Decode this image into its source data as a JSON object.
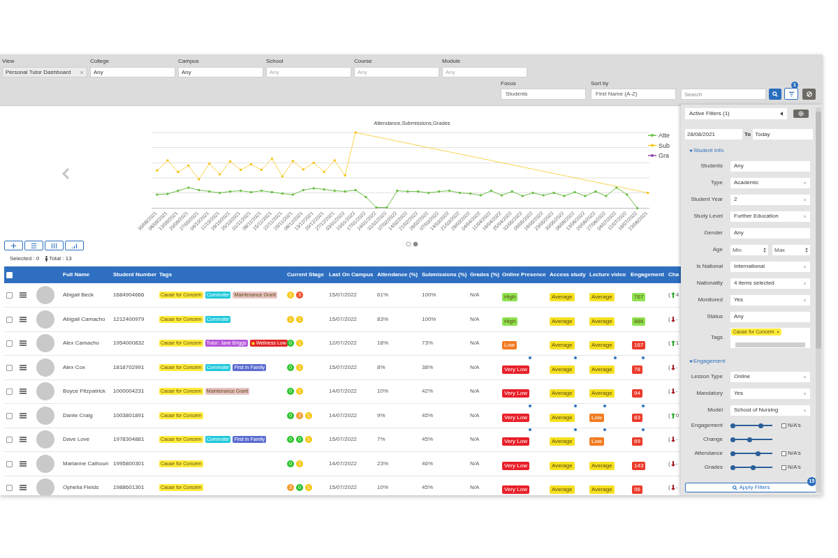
{
  "filters_bar": {
    "fields": [
      {
        "label": "View",
        "value": "Personal Tutor Dashboard",
        "clearable": true
      },
      {
        "label": "College",
        "value": "Any",
        "clearable": false
      },
      {
        "label": "Campus",
        "value": "Any",
        "clearable": false
      },
      {
        "label": "School",
        "placeholder": "Any",
        "clearable": false
      },
      {
        "label": "Course",
        "placeholder": "Any",
        "clearable": false
      },
      {
        "label": "Module",
        "placeholder": "Any",
        "clearable": false
      }
    ],
    "focus": {
      "label": "Focus",
      "value": "Students"
    },
    "sort": {
      "label": "Sort by",
      "value": "First Name (A-Z)"
    },
    "search": {
      "placeholder": "Search"
    },
    "filter_badge": "1"
  },
  "chart": {
    "title": "Attendance,Submissions,Grades",
    "x_labels": [
      "30/08/2021",
      "06/09/2021",
      "13/09/2021",
      "20/09/2021",
      "27/09/2021",
      "04/10/2021",
      "11/10/2021",
      "18/10/2021",
      "25/10/2021",
      "01/11/2021",
      "08/11/2021",
      "15/11/2021",
      "22/11/2021",
      "29/11/2021",
      "06/12/2021",
      "13/12/2021",
      "20/12/2021",
      "27/12/2021",
      "03/01/2022",
      "10/01/2022",
      "17/01/2022",
      "24/01/2022",
      "31/01/2022",
      "07/02/2022",
      "14/02/2022",
      "21/02/2022",
      "28/02/2022",
      "07/03/2022",
      "14/03/2022",
      "21/03/2022",
      "28/03/2022",
      "04/04/2022",
      "11/04/2022",
      "18/04/2022",
      "25/04/2022",
      "02/05/2022",
      "09/05/2022",
      "16/05/2022",
      "23/05/2022",
      "30/05/2022",
      "06/06/2022",
      "13/06/2022",
      "20/06/2022",
      "27/06/2022",
      "04/07/2022",
      "11/07/2022",
      "18/07/2022",
      "23/08/2021"
    ],
    "legend": [
      {
        "text": "Atte",
        "color": "#6cbf47"
      },
      {
        "text": "Sub",
        "color": "#f5c518"
      },
      {
        "text": "Gra",
        "color": "#8e44ad"
      }
    ],
    "carousel_dots": [
      {
        "selected": false
      },
      {
        "selected": true
      }
    ]
  },
  "summary": {
    "selected": "Selected : 0",
    "total": "Total : 13"
  },
  "table": {
    "select_all_checked": false,
    "columns": [
      "Full Name",
      "Student Number",
      "Tags",
      "Current Stage",
      "Last On Campus",
      "Attendance (%)",
      "Submissions (%)",
      "Grades (%)",
      "Online Presence",
      "Access study",
      "Lecture video",
      "Engagement",
      "Cha"
    ],
    "rows": [
      {
        "checked": false,
        "name": "Abigail Beck",
        "number": "1684904666",
        "tags": [
          {
            "text": "Cause for Concern",
            "color": "#ffeb3b",
            "has_icon": false
          },
          {
            "text": "Commuter",
            "color": "#1fc8db",
            "has_icon": false
          },
          {
            "text": "Maintenance Grant",
            "color": "#e8c4c4",
            "has_icon": false
          }
        ],
        "stages": [
          {
            "text": "1",
            "color": "#f7c71a"
          },
          {
            "text": "3",
            "color": "#f0502a"
          }
        ],
        "last_on_campus": "15/07/2022",
        "attendance": "61%",
        "submissions": "100%",
        "grades": "N/A",
        "online": {
          "text": "High",
          "color": "#8ee04e",
          "flag": false
        },
        "access": {
          "text": "Average",
          "color": "#f5e020",
          "flag": false
        },
        "lecture": {
          "text": "Average",
          "color": "#f5e020",
          "flag": false
        },
        "engagement": {
          "text": "767",
          "color": "#8ee04e",
          "flag": false
        },
        "change": {
          "prefix": "(",
          "rising": true,
          "value": "4"
        }
      },
      {
        "checked": false,
        "name": "Abigail Camacho",
        "number": "1212400979",
        "tags": [
          {
            "text": "Cause for Concern",
            "color": "#ffeb3b",
            "has_icon": false
          },
          {
            "text": "Commuter",
            "color": "#1fc8db",
            "has_icon": false
          }
        ],
        "stages": [
          {
            "text": "1",
            "color": "#f7c71a"
          },
          {
            "text": "1",
            "color": "#f7c71a"
          }
        ],
        "last_on_campus": "15/07/2022",
        "attendance": "83%",
        "submissions": "100%",
        "grades": "N/A",
        "online": {
          "text": "High",
          "color": "#8ee04e",
          "flag": false
        },
        "access": {
          "text": "Average",
          "color": "#f5e020",
          "flag": false
        },
        "lecture": {
          "text": "Average",
          "color": "#f5e020",
          "flag": false
        },
        "engagement": {
          "text": "886",
          "color": "#8ee04e",
          "flag": false
        },
        "change": {
          "prefix": "(",
          "rising": false,
          "value": "-"
        }
      },
      {
        "checked": false,
        "name": "Alex Camacho",
        "number": "1954000832",
        "tags": [
          {
            "text": "Cause for Concern",
            "color": "#ffeb3b",
            "has_icon": false
          },
          {
            "text": "Tutor: Jane Briggs",
            "color": "#b455d8",
            "has_icon": false
          },
          {
            "text": "Wellness Low",
            "color": "#e02424",
            "has_icon": true
          }
        ],
        "stages": [
          {
            "text": "0",
            "color": "#2bc42b"
          },
          {
            "text": "1",
            "color": "#f7c71a"
          }
        ],
        "last_on_campus": "12/07/2022",
        "attendance": "18%",
        "submissions": "73%",
        "grades": "N/A",
        "online": {
          "text": "Low",
          "color": "#f27c22",
          "flag": false
        },
        "access": {
          "text": "Average",
          "color": "#f5e020",
          "flag": false
        },
        "lecture": {
          "text": "Average",
          "color": "#f5e020",
          "flag": false
        },
        "engagement": {
          "text": "167",
          "color": "#ec3a2a",
          "flag": false
        },
        "change": {
          "prefix": "(",
          "rising": true,
          "value": "1"
        }
      },
      {
        "checked": false,
        "name": "Alex Cox",
        "number": "1818702991",
        "tags": [
          {
            "text": "Cause for Concern",
            "color": "#ffeb3b",
            "has_icon": false
          },
          {
            "text": "Commuter",
            "color": "#1fc8db",
            "has_icon": false
          },
          {
            "text": "First in Family",
            "color": "#5b6bd0",
            "has_icon": false
          }
        ],
        "stages": [
          {
            "text": "0",
            "color": "#2bc42b"
          },
          {
            "text": "1",
            "color": "#f7c71a"
          }
        ],
        "last_on_campus": "15/07/2022",
        "attendance": "8%",
        "submissions": "38%",
        "grades": "N/A",
        "online": {
          "text": "Very Low",
          "color": "#e8202a",
          "flag": true
        },
        "access": {
          "text": "Average",
          "color": "#f5e020",
          "flag": true
        },
        "lecture": {
          "text": "Average",
          "color": "#f5e020",
          "flag": true
        },
        "engagement": {
          "text": "78",
          "color": "#ec3a2a",
          "flag": true
        },
        "change": {
          "prefix": "(",
          "rising": false,
          "value": "-"
        }
      },
      {
        "checked": false,
        "name": "Boyce Fitzpatrick",
        "number": "1000004231",
        "tags": [
          {
            "text": "Cause for Concern",
            "color": "#ffeb3b",
            "has_icon": false
          },
          {
            "text": "Maintenance Grant",
            "color": "#e8c4c4",
            "has_icon": false
          }
        ],
        "stages": [
          {
            "text": "0",
            "color": "#2bc42b"
          },
          {
            "text": "1",
            "color": "#f7c71a"
          }
        ],
        "last_on_campus": "14/07/2022",
        "attendance": "10%",
        "submissions": "42%",
        "grades": "N/A",
        "online": {
          "text": "Very Low",
          "color": "#e8202a",
          "flag": false
        },
        "access": {
          "text": "Average",
          "color": "#f5e020",
          "flag": false
        },
        "lecture": {
          "text": "Average",
          "color": "#f5e020",
          "flag": false
        },
        "engagement": {
          "text": "94",
          "color": "#ec3a2a",
          "flag": false
        },
        "change": {
          "prefix": "(",
          "rising": false,
          "value": "-"
        }
      },
      {
        "checked": false,
        "name": "Dante Craig",
        "number": "1003801891",
        "tags": [
          {
            "text": "Cause for Concern",
            "color": "#ffeb3b",
            "has_icon": false
          }
        ],
        "stages": [
          {
            "text": "0",
            "color": "#2bc42b"
          },
          {
            "text": "3",
            "color": "#f39a2b"
          },
          {
            "text": "1",
            "color": "#f7c71a"
          }
        ],
        "last_on_campus": "14/07/2022",
        "attendance": "9%",
        "submissions": "45%",
        "grades": "N/A",
        "online": {
          "text": "Very Low",
          "color": "#e8202a",
          "flag": true
        },
        "access": {
          "text": "Average",
          "color": "#f5e020",
          "flag": true
        },
        "lecture": {
          "text": "Low",
          "color": "#f27c22",
          "flag": true
        },
        "engagement": {
          "text": "83",
          "color": "#ec3a2a",
          "flag": true
        },
        "change": {
          "prefix": "(",
          "rising": true,
          "value": "0"
        }
      },
      {
        "checked": false,
        "name": "Dave Love",
        "number": "1978304881",
        "tags": [
          {
            "text": "Cause for Concern",
            "color": "#ffeb3b",
            "has_icon": false
          },
          {
            "text": "Commuter",
            "color": "#1fc8db",
            "has_icon": false
          },
          {
            "text": "First in Family",
            "color": "#5b6bd0",
            "has_icon": false
          }
        ],
        "stages": [
          {
            "text": "0",
            "color": "#2bc42b"
          },
          {
            "text": "0",
            "color": "#2bc42b"
          },
          {
            "text": "1",
            "color": "#f7c71a"
          }
        ],
        "last_on_campus": "15/07/2022",
        "attendance": "7%",
        "submissions": "45%",
        "grades": "N/A",
        "online": {
          "text": "Very Low",
          "color": "#e8202a",
          "flag": true
        },
        "access": {
          "text": "Average",
          "color": "#f5e020",
          "flag": true
        },
        "lecture": {
          "text": "Low",
          "color": "#f27c22",
          "flag": true
        },
        "engagement": {
          "text": "69",
          "color": "#ec3a2a",
          "flag": true
        },
        "change": {
          "prefix": "(",
          "rising": false,
          "value": "-"
        }
      },
      {
        "checked": false,
        "name": "Marianne Calhoun",
        "number": "1995800301",
        "tags": [
          {
            "text": "Cause for Concern",
            "color": "#ffeb3b",
            "has_icon": false
          }
        ],
        "stages": [
          {
            "text": "0",
            "color": "#2bc42b"
          },
          {
            "text": "1",
            "color": "#f7c71a"
          }
        ],
        "last_on_campus": "14/07/2022",
        "attendance": "23%",
        "submissions": "46%",
        "grades": "N/A",
        "online": {
          "text": "Very Low",
          "color": "#e8202a",
          "flag": false
        },
        "access": {
          "text": "Average",
          "color": "#f5e020",
          "flag": false
        },
        "lecture": {
          "text": "Average",
          "color": "#f5e020",
          "flag": false
        },
        "engagement": {
          "text": "143",
          "color": "#ec3a2a",
          "flag": false
        },
        "change": {
          "prefix": "(",
          "rising": false,
          "value": "-"
        }
      },
      {
        "checked": false,
        "name": "Ophelia Fields",
        "number": "1988601301",
        "tags": [
          {
            "text": "Cause for Concern",
            "color": "#ffeb3b",
            "has_icon": false
          }
        ],
        "stages": [
          {
            "text": "3",
            "color": "#f39a2b"
          },
          {
            "text": "0",
            "color": "#2bc42b"
          },
          {
            "text": "1",
            "color": "#f7c71a"
          }
        ],
        "last_on_campus": "15/07/2022",
        "attendance": "10%",
        "submissions": "45%",
        "grades": "N/A",
        "online": {
          "text": "Very Low",
          "color": "#e8202a",
          "flag": false
        },
        "access": {
          "text": "Average",
          "color": "#f5e020",
          "flag": false
        },
        "lecture": {
          "text": "Average",
          "color": "#f5e020",
          "flag": false
        },
        "engagement": {
          "text": "96",
          "color": "#ec3a2a",
          "flag": false
        },
        "change": {
          "prefix": "(",
          "rising": false,
          "value": "-"
        }
      }
    ]
  },
  "panel": {
    "active_filters": "Active Filters (1)",
    "date_from": "28/08/2021",
    "to_label": "To",
    "date_to": "Today",
    "sections": [
      {
        "title": "Student Info",
        "expanded": true,
        "rows": [
          {
            "kind": "select",
            "label": "Students",
            "value": "Any",
            "clearable": false
          },
          {
            "kind": "select",
            "label": "Type",
            "value": "Academic",
            "clearable": true
          },
          {
            "kind": "select",
            "label": "Student Year",
            "value": "2",
            "clearable": true
          },
          {
            "kind": "select",
            "label": "Study Level",
            "value": "Further Education",
            "clearable": true
          },
          {
            "kind": "select",
            "label": "Gender",
            "value": "Any",
            "clearable": false
          },
          {
            "kind": "range",
            "label": "Age",
            "min_placeholder": "Min",
            "max_placeholder": "Max"
          },
          {
            "kind": "select",
            "label": "Is National",
            "value": "International",
            "clearable": true
          },
          {
            "kind": "select",
            "label": "Nationality",
            "value": "4 items selected",
            "clearable": true
          },
          {
            "kind": "select",
            "label": "Monitored",
            "value": "Yes",
            "clearable": true
          },
          {
            "kind": "select",
            "label": "Status",
            "value": "Any",
            "clearable": false
          },
          {
            "kind": "tags",
            "label": "Tags",
            "chips": [
              {
                "text": "Cause for Concern",
                "color": "#ffeb3b"
              }
            ]
          }
        ]
      },
      {
        "title": "Engagement",
        "expanded": true,
        "rows": [
          {
            "kind": "select",
            "label": "Lesson Type",
            "value": "Online",
            "clearable": true
          },
          {
            "kind": "select",
            "label": "Mandatory",
            "value": "Yes",
            "clearable": true
          },
          {
            "kind": "select",
            "label": "Model",
            "value": "School of Nursing",
            "clearable": true
          },
          {
            "kind": "slider",
            "label": "Engagement",
            "thumbs": [
              {
                "level": 0
              },
              {
                "level": 0.75
              }
            ],
            "na": {
              "label": "N/A's",
              "checked": false
            }
          },
          {
            "kind": "slider",
            "label": "Change",
            "thumbs": [
              {
                "level": 0
              },
              {
                "level": 0.45
              }
            ]
          },
          {
            "kind": "slider",
            "label": "Attendance",
            "thumbs": [
              {
                "level": 0
              },
              {
                "level": 0.68
              }
            ],
            "na": {
              "label": "N/A's",
              "checked": false
            }
          },
          {
            "kind": "slider",
            "label": "Grades",
            "thumbs": [
              {
                "level": 0
              },
              {
                "level": 0.55
              }
            ],
            "na": {
              "label": "N/A's",
              "checked": false
            }
          }
        ]
      }
    ],
    "apply": {
      "label": "Apply Filters",
      "badge": "15"
    }
  }
}
